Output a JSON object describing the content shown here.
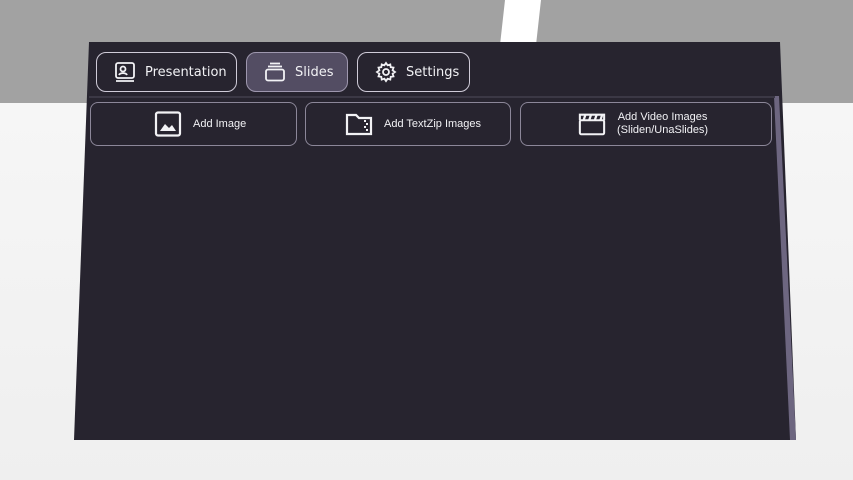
{
  "tabs": [
    {
      "id": "presentation",
      "label": "Presentation",
      "icon": "presentation-icon",
      "active": false
    },
    {
      "id": "slides",
      "label": "Slides",
      "icon": "slides-stack-icon",
      "active": true
    },
    {
      "id": "settings",
      "label": "Settings",
      "icon": "gear-icon",
      "active": false
    }
  ],
  "actions": {
    "add_image": {
      "label": "Add Image",
      "icon": "image-icon"
    },
    "add_textzip": {
      "label": "Add TextZip Images",
      "icon": "zip-folder-icon"
    },
    "add_video": {
      "label_line1": "Add Video Images",
      "label_line2": "(Sliden/UnaSlides)",
      "icon": "clapperboard-icon"
    }
  },
  "colors": {
    "panel_bg": "#27242f",
    "active_tab_bg": "#534d63",
    "text": "#f2f2f5",
    "border": "#cfcbd8"
  }
}
